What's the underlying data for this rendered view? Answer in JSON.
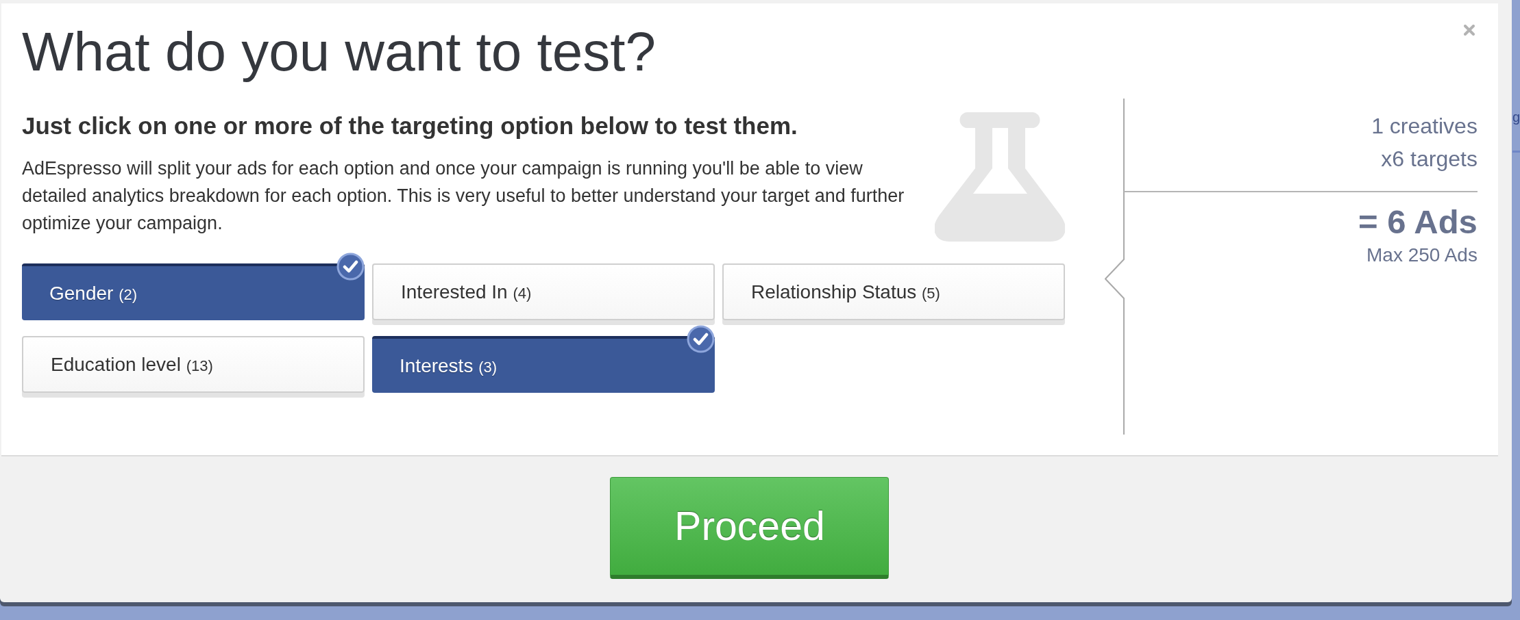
{
  "modal": {
    "title": "What do you want to test?",
    "subtitle": "Just click on one or more of the targeting option below to test them.",
    "description": "AdEspresso will split your ads for each option and once your campaign is running you'll be able to view detailed analytics breakdown for each option. This is very useful to better understand your target and further optimize your campaign.",
    "options": [
      {
        "label": "Gender",
        "count": "(2)",
        "selected": true
      },
      {
        "label": "Interested In",
        "count": "(4)",
        "selected": false
      },
      {
        "label": "Relationship Status",
        "count": "(5)",
        "selected": false
      },
      {
        "label": "Education level",
        "count": "(13)",
        "selected": false
      },
      {
        "label": "Interests",
        "count": "(3)",
        "selected": true
      }
    ],
    "summary": {
      "creatives": "1 creatives",
      "targets": "x6 targets",
      "total": "= 6 Ads",
      "limit": "Max 250 Ads"
    },
    "footer": {
      "button": "Proceed"
    }
  },
  "background": {
    "text_fragment": "g"
  }
}
